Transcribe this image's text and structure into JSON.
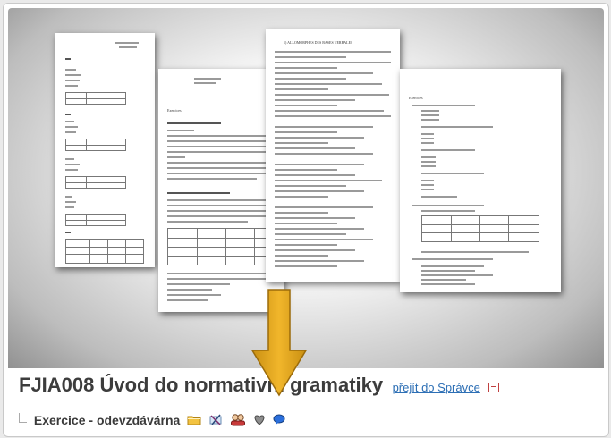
{
  "course": {
    "code_title": "FJIA008 Úvod do normativní gramatiky",
    "admin_link": "přejít do Správce"
  },
  "item": {
    "label": "Exercice - odevzdávárna"
  },
  "icons": {
    "folder": "folder-icon",
    "no-access": "no-access-icon",
    "people": "people-icon",
    "heart": "heart-icon",
    "chat": "chat-bubble-icon",
    "manage": "manage-icon"
  },
  "colors": {
    "title": "#3c3c3c",
    "link": "#2d6fb5",
    "arrow": "#e0a81c"
  },
  "preview_pages": {
    "page2_header": "Exercices",
    "page3_title": "1) ALLOMORPHES DES BASES VERBALES",
    "page4_header": "Exercices"
  }
}
